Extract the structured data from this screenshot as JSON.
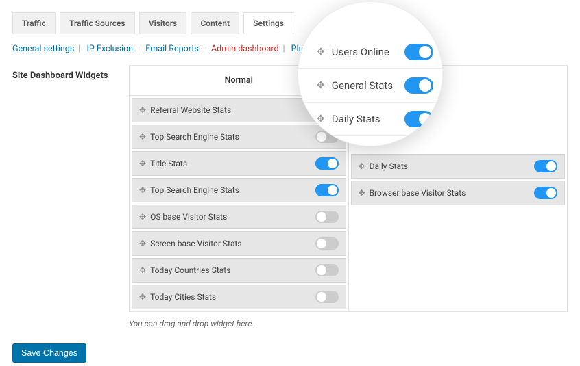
{
  "tabs": [
    {
      "label": "Traffic"
    },
    {
      "label": "Traffic Sources"
    },
    {
      "label": "Visitors"
    },
    {
      "label": "Content"
    },
    {
      "label": "Settings",
      "active": true
    }
  ],
  "subnav": [
    {
      "label": "General settings"
    },
    {
      "label": "IP Exclusion"
    },
    {
      "label": "Email Reports"
    },
    {
      "label": "Admin dashboard",
      "active": true
    },
    {
      "label": "Plugin Main Page (statistics"
    }
  ],
  "section_title": "Site Dashboard Widgets",
  "columns": {
    "left": {
      "header": "Normal",
      "widgets": [
        {
          "label": "Referral Website Stats",
          "on": false
        },
        {
          "label": "Top Search Engine Stats",
          "on": false
        },
        {
          "label": "Title Stats",
          "on": true
        },
        {
          "label": "Top Search Engine Stats",
          "on": true
        },
        {
          "label": "OS base Visitor Stats",
          "on": false
        },
        {
          "label": "Screen base Visitor Stats",
          "on": false
        },
        {
          "label": "Today Countries Stats",
          "on": false
        },
        {
          "label": "Today Cities Stats",
          "on": false
        }
      ]
    },
    "right": {
      "widgets_visible": [
        {
          "label": "Daily Stats",
          "on": true
        },
        {
          "label": "Browser base Visitor Stats",
          "on": true
        }
      ]
    }
  },
  "magnifier": [
    {
      "label": "Users Online",
      "on": true
    },
    {
      "label": "General Stats",
      "on": true
    },
    {
      "label": "Daily Stats",
      "on": true
    }
  ],
  "hint": "You can drag and drop widget here.",
  "save_label": "Save Changes"
}
